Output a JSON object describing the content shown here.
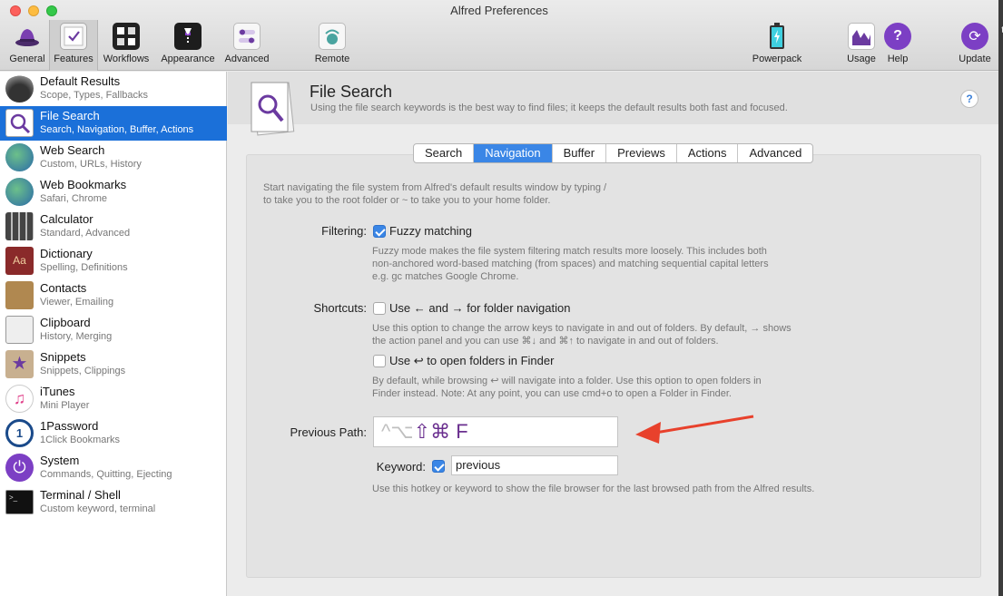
{
  "window": {
    "title": "Alfred Preferences",
    "right_edge_char": "t"
  },
  "toolbar": {
    "items": [
      {
        "label": "General",
        "icon": "hat-icon"
      },
      {
        "label": "Features",
        "icon": "checklist-icon",
        "selected": true
      },
      {
        "label": "Workflows",
        "icon": "workflows-icon"
      },
      {
        "label": "Appearance",
        "icon": "tuxedo-icon"
      },
      {
        "label": "Advanced",
        "icon": "toggles-icon"
      },
      {
        "label": "Remote",
        "icon": "remote-icon"
      },
      {
        "label": "Powerpack",
        "icon": "battery-icon"
      },
      {
        "label": "Usage",
        "icon": "chart-icon"
      },
      {
        "label": "Help",
        "icon": "question-icon"
      },
      {
        "label": "Update",
        "icon": "update-icon"
      }
    ]
  },
  "sidebar": {
    "items": [
      {
        "title": "Default Results",
        "subtitle": "Scope, Types, Fallbacks"
      },
      {
        "title": "File Search",
        "subtitle": "Search, Navigation, Buffer, Actions",
        "active": true
      },
      {
        "title": "Web Search",
        "subtitle": "Custom, URLs, History"
      },
      {
        "title": "Web Bookmarks",
        "subtitle": "Safari, Chrome"
      },
      {
        "title": "Calculator",
        "subtitle": "Standard, Advanced"
      },
      {
        "title": "Dictionary",
        "subtitle": "Spelling, Definitions"
      },
      {
        "title": "Contacts",
        "subtitle": "Viewer, Emailing"
      },
      {
        "title": "Clipboard",
        "subtitle": "History, Merging"
      },
      {
        "title": "Snippets",
        "subtitle": "Snippets, Clippings"
      },
      {
        "title": "iTunes",
        "subtitle": "Mini Player"
      },
      {
        "title": "1Password",
        "subtitle": "1Click Bookmarks"
      },
      {
        "title": "System",
        "subtitle": "Commands, Quitting, Ejecting"
      },
      {
        "title": "Terminal / Shell",
        "subtitle": "Custom keyword, terminal"
      }
    ]
  },
  "header": {
    "title": "File Search",
    "description": "Using the file search keywords is the best way to find files; it keeps the default results both fast and focused.",
    "help": "?"
  },
  "tabs": [
    {
      "label": "Search"
    },
    {
      "label": "Navigation",
      "active": true
    },
    {
      "label": "Buffer"
    },
    {
      "label": "Previews"
    },
    {
      "label": "Actions"
    },
    {
      "label": "Advanced"
    }
  ],
  "navigation": {
    "intro_line1": "Start navigating the file system from Alfred's default results window by typing /",
    "intro_line2": "to take you to the root folder or ~ to take you to your home folder.",
    "filtering_label": "Filtering:",
    "fuzzy_label": "Fuzzy matching",
    "fuzzy_checked": true,
    "fuzzy_help1": "Fuzzy mode makes the file system filtering match results more loosely. This includes both",
    "fuzzy_help2": "non-anchored word-based matching (from spaces) and matching sequential capital letters",
    "fuzzy_help3": "e.g. gc matches Google Chrome.",
    "shortcuts_label": "Shortcuts:",
    "arrows_label": "Use ← and → for folder navigation",
    "arrows_checked": false,
    "arrows_help1": "Use this option to change the arrow keys to navigate in and out of folders. By default, → shows",
    "arrows_help2": "the action panel and you can use ⌘↓ and ⌘↑ to navigate in and out of folders.",
    "finder_label": "Use ↩ to open folders in Finder",
    "finder_checked": false,
    "finder_help1": "By default, while browsing ↩ will navigate into a folder. Use this option to open folders in",
    "finder_help2": "Finder instead. Note: At any point, you can use cmd+o to open a Folder in Finder.",
    "previous_path_label": "Previous Path:",
    "hotkey_faint": "^⌥",
    "hotkey_strong": "⇧⌘ F",
    "keyword_label": "Keyword:",
    "keyword_checked": true,
    "keyword_value": "previous",
    "previous_help": "Use this hotkey or keyword to show the file browser for the last browsed path from the Alfred results."
  },
  "colors": {
    "selection_blue": "#1b70d9",
    "tab_blue": "#3a86e6",
    "annotation_arrow": "#e8412c"
  }
}
